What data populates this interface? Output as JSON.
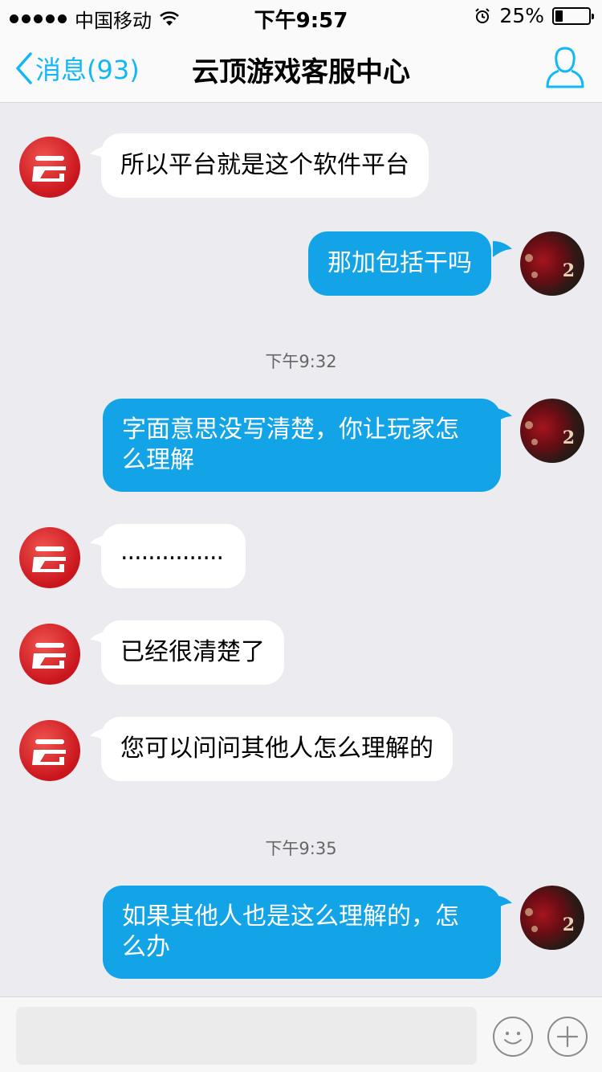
{
  "status_bar": {
    "carrier": "中国移动",
    "time": "下午9:57",
    "battery_text": "25%",
    "battery_level": 0.25,
    "icons": [
      "signal-dots-icon",
      "wifi-icon",
      "alarm-icon",
      "battery-icon"
    ]
  },
  "nav": {
    "back_label": "消息(93)",
    "title": "云顶游戏客服中心",
    "profile_icon": "person-icon"
  },
  "messages": [
    {
      "side": "left",
      "text": "所以平台就是这个软件平台"
    },
    {
      "side": "right",
      "text": "那加包括干吗"
    },
    {
      "timestamp": "下午9:32"
    },
    {
      "side": "right",
      "text_line1": "字面意思没写清楚，你让玩家怎",
      "text_line2": "么理解"
    },
    {
      "side": "left",
      "text": "..............."
    },
    {
      "side": "left",
      "text": "已经很清楚了"
    },
    {
      "side": "left",
      "text": "您可以问问其他人怎么理解的"
    },
    {
      "timestamp": "下午9:35"
    },
    {
      "side": "right",
      "text_line1": "如果其他人也是这么理解的，怎",
      "text_line2": "么办"
    }
  ],
  "input": {
    "value": "",
    "placeholder": "",
    "emoji_icon": "smiley-icon",
    "plus_icon": "plus-icon"
  },
  "colors": {
    "accent": "#12b7f5",
    "right_bubble": "#13a4e8",
    "left_bubble": "#ffffff",
    "background": "#ebebf0",
    "service_avatar": "#d0202a"
  },
  "service_avatar_char": "云"
}
